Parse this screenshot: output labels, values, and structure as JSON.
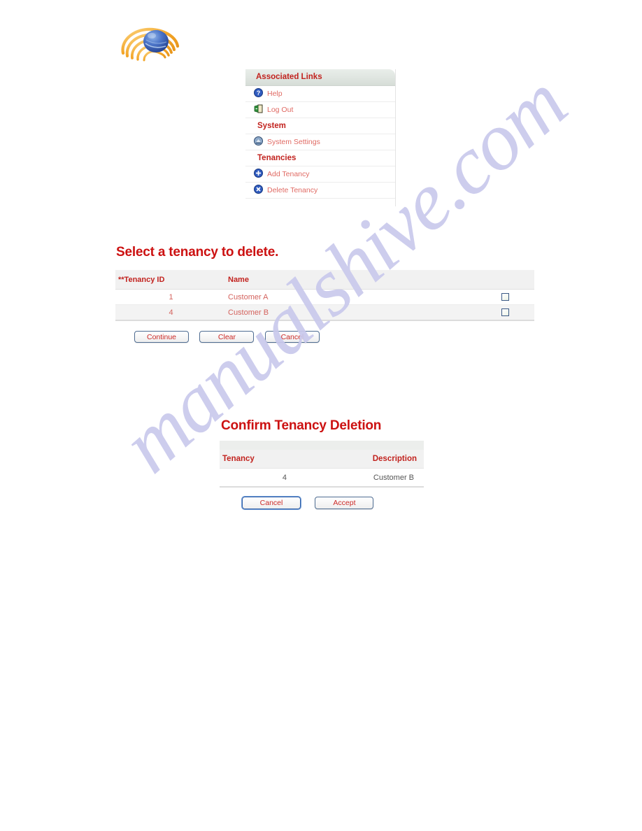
{
  "logo": {
    "name": "company-logo",
    "sphere_color": "#3b62b5",
    "ring_color": "#f0a018"
  },
  "watermark": {
    "text": "manualshive.com",
    "color": "#c9c9ec"
  },
  "associated_links": {
    "header": "Associated Links",
    "items": [
      {
        "label": "Help",
        "icon": "help-icon",
        "type": "link"
      },
      {
        "label": "Log Out",
        "icon": "logout-icon",
        "type": "link"
      },
      {
        "label": "System",
        "icon": "",
        "type": "section"
      },
      {
        "label": "System Settings",
        "icon": "system-settings-icon",
        "type": "link"
      },
      {
        "label": "Tenancies",
        "icon": "",
        "type": "section"
      },
      {
        "label": "Add Tenancy",
        "icon": "add-icon",
        "type": "link"
      },
      {
        "label": "Delete Tenancy",
        "icon": "delete-icon",
        "type": "link"
      }
    ]
  },
  "select_tenancy": {
    "title": "Select a tenancy to delete.",
    "columns": [
      "**Tenancy ID",
      "Name",
      "",
      ""
    ],
    "rows": [
      {
        "id": "1",
        "name": "Customer A",
        "checked": false
      },
      {
        "id": "4",
        "name": "Customer B",
        "checked": false
      }
    ],
    "buttons": [
      {
        "label": "Continue",
        "focused": false
      },
      {
        "label": "Clear",
        "focused": false
      },
      {
        "label": "Cancel",
        "focused": false
      }
    ]
  },
  "confirm_deletion": {
    "title": "Confirm Tenancy Deletion",
    "columns": [
      "Tenancy",
      "Description"
    ],
    "rows": [
      {
        "tenancy": "4",
        "description": "Customer B"
      }
    ],
    "buttons": [
      {
        "label": "Cancel",
        "focused": true
      },
      {
        "label": "Accept",
        "focused": false
      }
    ]
  },
  "colors": {
    "heading_red": "#cc1111",
    "label_red": "#c2231f",
    "link_red": "#e06a63",
    "header_bg": "#f1f1f1",
    "row_alt_bg": "#f3f3f3"
  }
}
